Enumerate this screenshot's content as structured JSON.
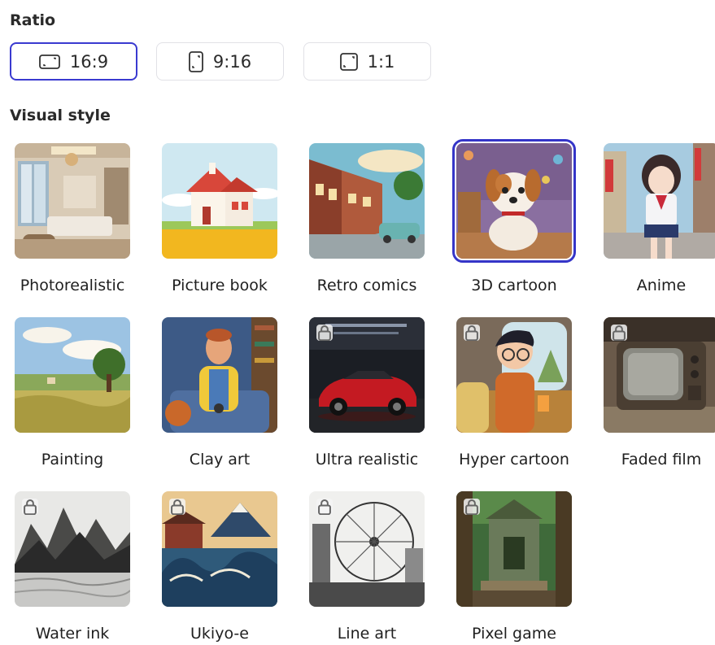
{
  "ratio": {
    "title": "Ratio",
    "options": [
      {
        "label": "16:9",
        "icon": "landscape-ratio-icon",
        "selected": true
      },
      {
        "label": "9:16",
        "icon": "portrait-ratio-icon",
        "selected": false
      },
      {
        "label": "1:1",
        "icon": "square-ratio-icon",
        "selected": false
      }
    ]
  },
  "visual_style": {
    "title": "Visual style",
    "items": [
      {
        "label": "Photorealistic",
        "locked": false,
        "selected": false
      },
      {
        "label": "Picture book",
        "locked": false,
        "selected": false
      },
      {
        "label": "Retro comics",
        "locked": false,
        "selected": false
      },
      {
        "label": "3D cartoon",
        "locked": false,
        "selected": true
      },
      {
        "label": "Anime",
        "locked": false,
        "selected": false
      },
      {
        "label": "Painting",
        "locked": false,
        "selected": false
      },
      {
        "label": "Clay art",
        "locked": false,
        "selected": false
      },
      {
        "label": "Ultra realistic",
        "locked": true,
        "selected": false
      },
      {
        "label": "Hyper cartoon",
        "locked": true,
        "selected": false
      },
      {
        "label": "Faded film",
        "locked": true,
        "selected": false
      },
      {
        "label": "Water ink",
        "locked": true,
        "selected": false
      },
      {
        "label": "Ukiyo-e",
        "locked": true,
        "selected": false
      },
      {
        "label": "Line art",
        "locked": true,
        "selected": false
      },
      {
        "label": "Pixel game",
        "locked": true,
        "selected": false
      }
    ]
  },
  "colors": {
    "accent": "#3535c8",
    "border": "#e1e1e6",
    "text": "#1f1f1f"
  }
}
